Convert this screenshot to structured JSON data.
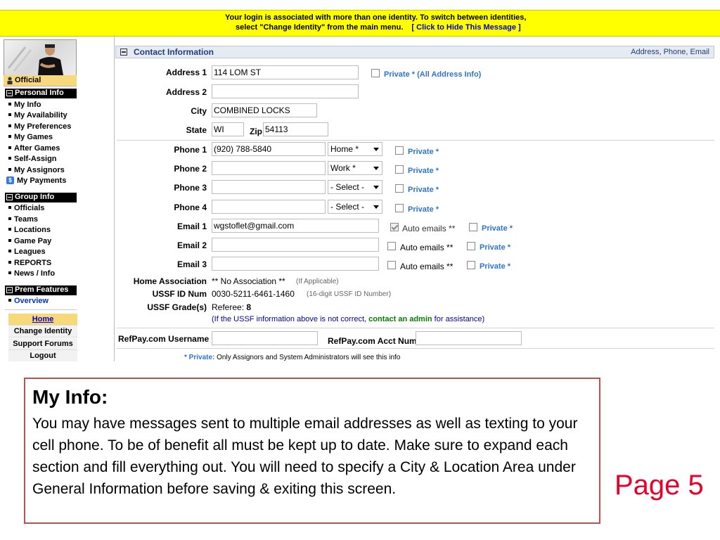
{
  "banner": {
    "line1": "Your login is associated with more than one identity. To switch between identities,",
    "line2": "select \"Change Identity\" from the main menu.",
    "hide_link": "[ Click to Hide This Message ]"
  },
  "sidebar": {
    "official": "Official",
    "personal_info": {
      "header": "Personal Info",
      "items": [
        "My Info",
        "My Availability",
        "My Preferences",
        "My Games",
        "After Games",
        "Self-Assign",
        "My Assignors",
        "My Payments"
      ]
    },
    "group_info": {
      "header": "Group Info",
      "items": [
        "Officials",
        "Teams",
        "Locations",
        "Game Pay",
        "Leagues",
        "REPORTS",
        "News / Info"
      ]
    },
    "prem_features": {
      "header": "Prem Features",
      "items": [
        "Overview"
      ]
    },
    "bottom": [
      "Home",
      "Change Identity",
      "Support Forums",
      "Logout"
    ]
  },
  "panel": {
    "title": "Contact Information",
    "right": "Address, Phone, Email"
  },
  "address": {
    "address1_label": "Address 1",
    "address1": "114 LOM ST",
    "private_all": "Private * (All Address Info)",
    "address2_label": "Address 2",
    "address2": "",
    "city_label": "City",
    "city": "COMBINED LOCKS",
    "state_label": "State",
    "state": "WI",
    "zip_label": "Zip",
    "zip": "54113"
  },
  "phones": [
    {
      "label": "Phone 1",
      "value": "(920) 788-5840",
      "type": "Home *",
      "private": "Private *"
    },
    {
      "label": "Phone 2",
      "value": "",
      "type": "Work *",
      "private": "Private *"
    },
    {
      "label": "Phone 3",
      "value": "",
      "type": "- Select -",
      "private": "Private *"
    },
    {
      "label": "Phone 4",
      "value": "",
      "type": "- Select -",
      "private": "Private *"
    }
  ],
  "emails": [
    {
      "label": "Email 1",
      "value": "wgstoflet@gmail.com",
      "auto": "Auto emails **",
      "private": "Private *"
    },
    {
      "label": "Email 2",
      "value": "",
      "auto": "Auto emails **",
      "private": "Private *"
    },
    {
      "label": "Email 3",
      "value": "",
      "auto": "Auto emails **",
      "private": "Private *"
    }
  ],
  "ussf": {
    "home_assoc_label": "Home Association",
    "home_assoc": "** No Association **",
    "home_assoc_hint": "(If Applicable)",
    "id_label": "USSF ID Num",
    "id": "0030-5211-6461-1460",
    "id_hint": "(16-digit USSF ID Number)",
    "grade_label": "USSF Grade(s)",
    "grade_prefix": "Referee: ",
    "grade_value": "8",
    "note_a": "(If the USSF information above is not correct, ",
    "note_link": "contact an admin",
    "note_b": " for assistance)"
  },
  "refpay": {
    "username_label": "RefPay.com Username",
    "username": "",
    "acct_label": "RefPay.com Acct Num",
    "acct": ""
  },
  "footnote": {
    "bold": "* Private:",
    "text": " Only Assignors and System Administrators will see this info"
  },
  "slide": {
    "title": "My Info:",
    "body": "You may have messages sent to multiple email addresses as well as texting to your cell phone. To be of benefit all must be kept up to date.   Make sure to expand each section and fill everything out.  You will need to specify a City & Location Area under General Information before saving & exiting this screen.",
    "page": "Page 5"
  },
  "colors": {
    "banner": "#ffff00",
    "accent_blue": "#2e74d0",
    "slide_border": "#c0504d",
    "page_number": "#e8002a"
  }
}
